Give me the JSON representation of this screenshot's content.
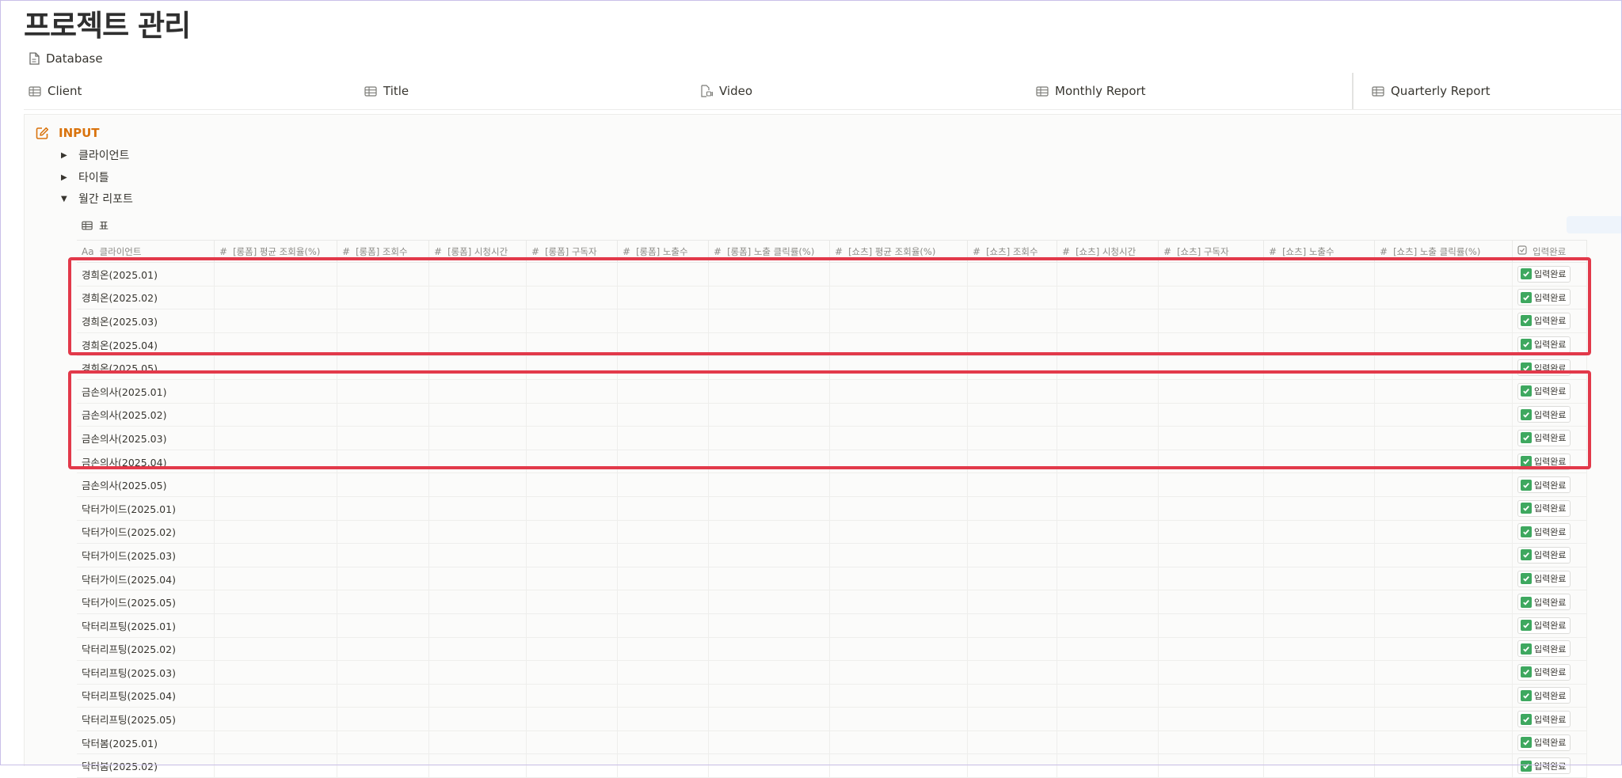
{
  "page": {
    "title": "프로젝트 관리",
    "database_link": "Database"
  },
  "views": [
    {
      "label": "Client",
      "icon": "table-icon"
    },
    {
      "label": "Title",
      "icon": "table-icon"
    },
    {
      "label": "Video",
      "icon": "video-file-icon"
    },
    {
      "label": "Monthly Report",
      "icon": "table-icon"
    },
    {
      "label": "Quarterly Report",
      "icon": "table-icon"
    }
  ],
  "callout": {
    "title": "INPUT",
    "toggles": [
      {
        "label": "클라이언트",
        "expanded": false
      },
      {
        "label": "타이틀",
        "expanded": false
      },
      {
        "label": "월간 리포트",
        "expanded": true
      }
    ]
  },
  "table": {
    "view_label": "표",
    "name_header": "클라이언트",
    "name_header_icon": "Aa",
    "columns": [
      "[롱폼] 평균 조회율(%)",
      "[롱폼] 조회수",
      "[롱폼] 시청시간",
      "[롱폼] 구독자",
      "[롱폼] 노출수",
      "[롱폼] 노출 클릭률(%)",
      "[쇼츠] 평균 조회율(%)",
      "[쇼츠] 조회수",
      "[쇼츠] 시청시간",
      "[쇼츠] 구독자",
      "[쇼츠] 노출수",
      "[쇼츠] 노출 클릭률(%)"
    ],
    "status_header": "입력완료",
    "status_label": "입력완료",
    "rows": [
      "경희온(2025.01)",
      "경희온(2025.02)",
      "경희온(2025.03)",
      "경희온(2025.04)",
      "경희온(2025.05)",
      "금손의사(2025.01)",
      "금손의사(2025.02)",
      "금손의사(2025.03)",
      "금손의사(2025.04)",
      "금손의사(2025.05)",
      "닥터가이드(2025.01)",
      "닥터가이드(2025.02)",
      "닥터가이드(2025.03)",
      "닥터가이드(2025.04)",
      "닥터가이드(2025.05)",
      "닥터리프팅(2025.01)",
      "닥터리프팅(2025.02)",
      "닥터리프팅(2025.03)",
      "닥터리프팅(2025.04)",
      "닥터리프팅(2025.05)",
      "닥터봄(2025.01)",
      "닥터봄(2025.02)"
    ]
  },
  "colors": {
    "accent_orange": "#d9730d",
    "highlight_red": "#e2394a",
    "check_green": "#3ea85f"
  }
}
